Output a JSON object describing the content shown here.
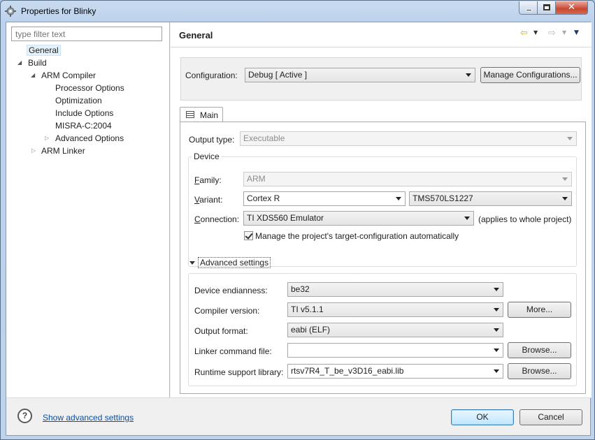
{
  "window": {
    "title": "Properties for Blinky"
  },
  "filter": {
    "placeholder": "type filter text"
  },
  "tree": {
    "general": "General",
    "build": "Build",
    "arm_compiler": "ARM Compiler",
    "processor_options": "Processor Options",
    "optimization": "Optimization",
    "include_options": "Include Options",
    "misra": "MISRA-C:2004",
    "advanced_options": "Advanced Options",
    "arm_linker": "ARM Linker"
  },
  "header": {
    "title": "General"
  },
  "configuration": {
    "label": "Configuration:",
    "value": "Debug  [ Active ]",
    "manage_button": "Manage Configurations..."
  },
  "tabs": {
    "main": "Main"
  },
  "output_type": {
    "label": "Output type:",
    "value": "Executable"
  },
  "device": {
    "group_title": "Device",
    "family_label": "Family:",
    "family_label_u": "F",
    "family_label_rest": "amily:",
    "family_value": "ARM",
    "variant_label_u": "V",
    "variant_label_rest": "ariant:",
    "variant_value": "Cortex R",
    "variant_part": "TMS570LS1227",
    "connection_label_u": "C",
    "connection_label_rest": "onnection:",
    "connection_value": "TI XDS560 Emulator",
    "connection_note": "(applies to whole project)",
    "manage_checkbox": "Manage the project's target-configuration automatically",
    "manage_checked": true
  },
  "advanced": {
    "toggle": "Advanced settings",
    "endianness_label": "Device endianness:",
    "endianness_value": "be32",
    "compiler_label": "Compiler version:",
    "compiler_value": "TI v5.1.1",
    "more_button": "More...",
    "format_label": "Output format:",
    "format_value": "eabi (ELF)",
    "linker_label": "Linker command file:",
    "linker_value": "",
    "browse_button": "Browse...",
    "runtime_label": "Runtime support library:",
    "runtime_value": "rtsv7R4_T_be_v3D16_eabi.lib"
  },
  "footer": {
    "help_icon": "?",
    "show_advanced": "Show advanced settings",
    "ok": "OK",
    "cancel": "Cancel"
  }
}
